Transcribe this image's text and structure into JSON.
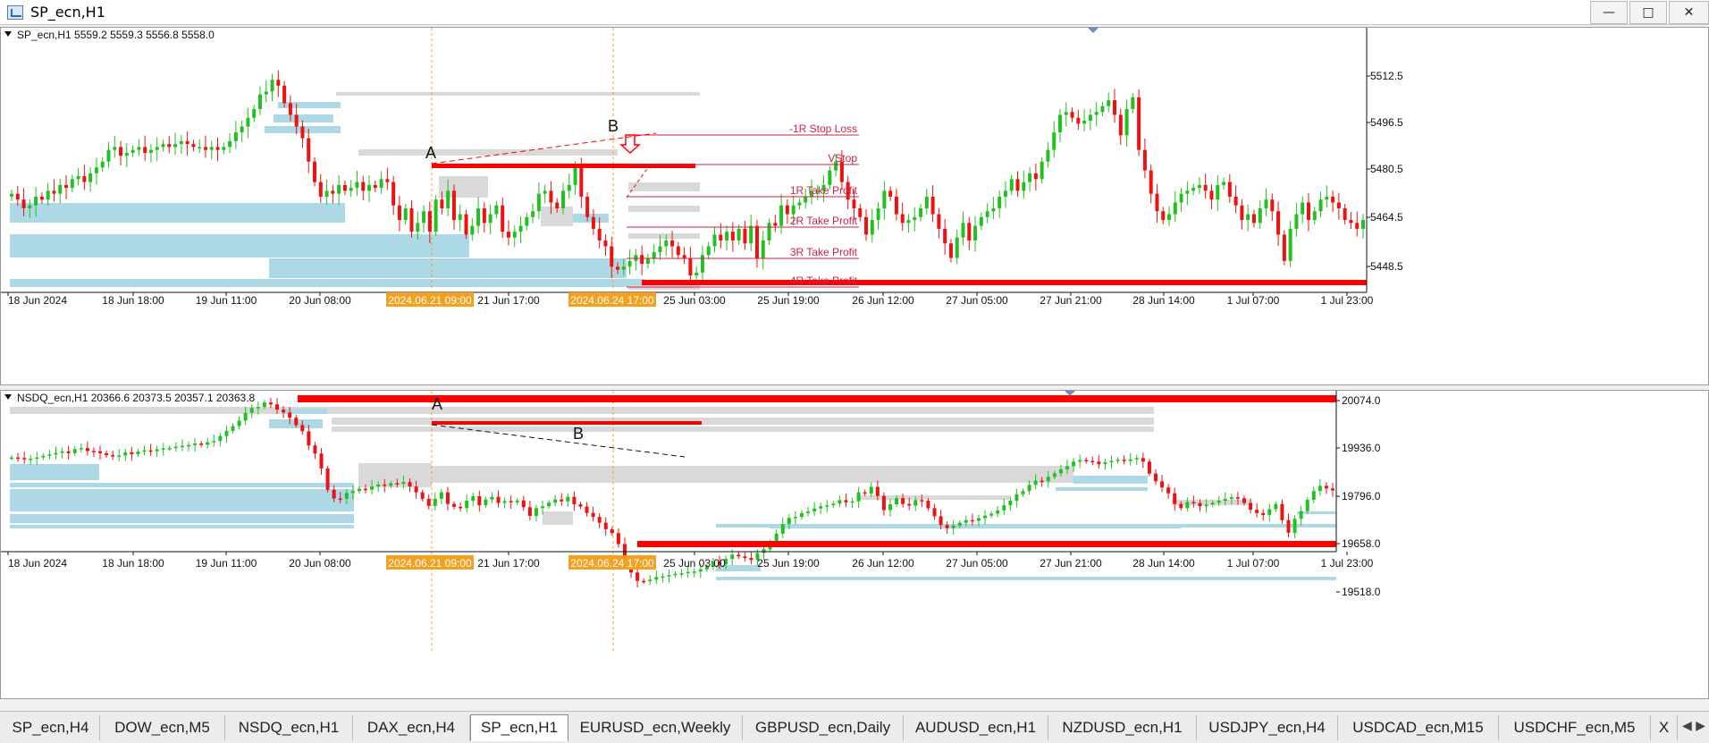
{
  "window": {
    "title": "SP_ecn,H1",
    "controls": {
      "minimize": "—",
      "maximize": "□",
      "close": "✕"
    }
  },
  "colors": {
    "bull": "#22c122",
    "bear": "#ee1111",
    "demand": "#add8e6",
    "supply": "#d9d9d9",
    "level": "#ff0000",
    "label": "#cc2244",
    "vline": "#f0a030",
    "highlight": "#f5a01e"
  },
  "charts": [
    {
      "id": "sp",
      "header": "SP_ecn,H1  5559.2 5559.3 5556.8 5558.0",
      "price_ticks": [
        "5512.5",
        "5496.5",
        "5480.5",
        "5464.5",
        "5448.5"
      ],
      "time_ticks": [
        "18 Jun 2024",
        "18 Jun 18:00",
        "19 Jun 11:00",
        "20 Jun 08:00",
        "2024.06.21 09:00",
        "21 Jun 17:00",
        "2024.06.24 17:00",
        "25 Jun 03:00",
        "25 Jun 19:00",
        "26 Jun 12:00",
        "27 Jun 05:00",
        "27 Jun 21:00",
        "28 Jun 14:00",
        "1 Jul 07:00",
        "1 Jul 23:00"
      ],
      "point_labels": [
        "A",
        "B"
      ],
      "level_labels": [
        "-1R Stop Loss",
        "VStop",
        "1R Take Profit",
        "2R Take Profit",
        "3R Take Profit",
        "4R Take Profit"
      ],
      "price_range": [
        5440,
        5530
      ],
      "closes": [
        5475,
        5473,
        5470,
        5471,
        5474,
        5473,
        5476,
        5475,
        5478,
        5477,
        5480,
        5481,
        5479,
        5482,
        5484,
        5486,
        5490,
        5491,
        5488,
        5489,
        5490,
        5491,
        5489,
        5490,
        5491,
        5492,
        5491,
        5492,
        5493,
        5492,
        5491,
        5491,
        5490,
        5491,
        5490,
        5491,
        5493,
        5496,
        5498,
        5501,
        5504,
        5509,
        5510,
        5514,
        5512,
        5506,
        5502,
        5498,
        5494,
        5486,
        5479,
        5474,
        5476,
        5475,
        5478,
        5476,
        5477,
        5479,
        5476,
        5478,
        5477,
        5480,
        5479,
        5471,
        5466,
        5470,
        5462,
        5465,
        5469,
        5462,
        5473,
        5470,
        5476,
        5466,
        5468,
        5461,
        5464,
        5470,
        5465,
        5468,
        5471,
        5462,
        5460,
        5462,
        5464,
        5467,
        5469,
        5475,
        5476,
        5472,
        5470,
        5476,
        5478,
        5484,
        5474,
        5467,
        5463,
        5459,
        5457,
        5450,
        5449,
        5450,
        5452,
        5454,
        5451,
        5453,
        5455,
        5457,
        5459,
        5457,
        5454,
        5453,
        5447,
        5448,
        5454,
        5457,
        5461,
        5459,
        5462,
        5459,
        5463,
        5458,
        5464,
        5453,
        5459,
        5465,
        5464,
        5471,
        5468,
        5471,
        5472,
        5474,
        5476,
        5476,
        5478,
        5483,
        5486,
        5479,
        5473,
        5470,
        5467,
        5461,
        5466,
        5470,
        5476,
        5474,
        5468,
        5465,
        5466,
        5467,
        5470,
        5474,
        5468,
        5463,
        5458,
        5453,
        5460,
        5465,
        5459,
        5464,
        5467,
        5469,
        5470,
        5474,
        5476,
        5480,
        5476,
        5479,
        5482,
        5480,
        5486,
        5490,
        5496,
        5502,
        5503,
        5501,
        5499,
        5500,
        5502,
        5503,
        5505,
        5507,
        5502,
        5495,
        5504,
        5508,
        5490,
        5483,
        5475,
        5469,
        5466,
        5468,
        5472,
        5475,
        5476,
        5477,
        5478,
        5476,
        5473,
        5478,
        5479,
        5474,
        5471,
        5466,
        5468,
        5465,
        5470,
        5473,
        5469,
        5461,
        5452,
        5463,
        5468,
        5472,
        5466,
        5469,
        5473,
        5474,
        5472,
        5470,
        5466,
        5465,
        5463,
        5466
      ]
    },
    {
      "id": "nsdq",
      "header": "NSDQ_ecn,H1  20366.6 20373.5 20357.1 20363.8",
      "price_ticks": [
        "20074.0",
        "19936.0",
        "19796.0",
        "19658.0",
        "19518.0"
      ],
      "time_ticks": [
        "18 Jun 2024",
        "18 Jun 18:00",
        "19 Jun 11:00",
        "20 Jun 08:00",
        "2024.06.21 09:00",
        "21 Jun 17:00",
        "2024.06.24 17:00",
        "25 Jun 03:00",
        "25 Jun 19:00",
        "26 Jun 12:00",
        "27 Jun 05:00",
        "27 Jun 21:00",
        "28 Jun 14:00",
        "1 Jul 07:00",
        "1 Jul 23:00"
      ],
      "point_labels": [
        "A",
        "B"
      ],
      "price_range": [
        19470,
        20120
      ],
      "closes": [
        19886,
        19884,
        19880,
        19882,
        19886,
        19891,
        19895,
        19900,
        19905,
        19899,
        19912,
        19915,
        19906,
        19905,
        19899,
        19893,
        19889,
        19892,
        19902,
        19896,
        19904,
        19908,
        19905,
        19911,
        19914,
        19915,
        19919,
        19922,
        19924,
        19929,
        19925,
        19933,
        19937,
        19952,
        19968,
        19983,
        20000,
        20024,
        20039,
        20042,
        20056,
        20050,
        20034,
        20025,
        20009,
        19986,
        19967,
        19923,
        19898,
        19852,
        19786,
        19759,
        19758,
        19776,
        19782,
        19789,
        19786,
        19796,
        19802,
        19798,
        19806,
        19804,
        19810,
        19796,
        19778,
        19758,
        19736,
        19758,
        19778,
        19742,
        19733,
        19729,
        19752,
        19766,
        19738,
        19756,
        19764,
        19745,
        19751,
        19747,
        19753,
        19732,
        19705,
        19729,
        19735,
        19746,
        19756,
        19750,
        19764,
        19741,
        19734,
        19714,
        19702,
        19684,
        19664,
        19652,
        19618,
        19558,
        19530,
        19504,
        19503,
        19508,
        19516,
        19518,
        19522,
        19526,
        19528,
        19532,
        19533,
        19540,
        19548,
        19562,
        19555,
        19572,
        19585,
        19580,
        19575,
        19569,
        19590,
        19602,
        19624,
        19650,
        19680,
        19699,
        19702,
        19714,
        19719,
        19728,
        19735,
        19738,
        19743,
        19754,
        19747,
        19750,
        19778,
        19774,
        19795,
        19767,
        19723,
        19741,
        19760,
        19742,
        19737,
        19754,
        19752,
        19729,
        19704,
        19677,
        19667,
        19675,
        19684,
        19692,
        19690,
        19698,
        19706,
        19712,
        19722,
        19738,
        19752,
        19772,
        19782,
        19801,
        19814,
        19812,
        19826,
        19837,
        19849,
        19859,
        19873,
        19878,
        19875,
        19873,
        19865,
        19871,
        19875,
        19879,
        19875,
        19880,
        19884,
        19873,
        19836,
        19812,
        19793,
        19775,
        19742,
        19729,
        19748,
        19745,
        19735,
        19740,
        19746,
        19752,
        19758,
        19763,
        19760,
        19745,
        19724,
        19714,
        19708,
        19726,
        19742,
        19692,
        19653,
        19696,
        19720,
        19755,
        19782,
        19798,
        19790,
        19784
      ]
    }
  ]
}
